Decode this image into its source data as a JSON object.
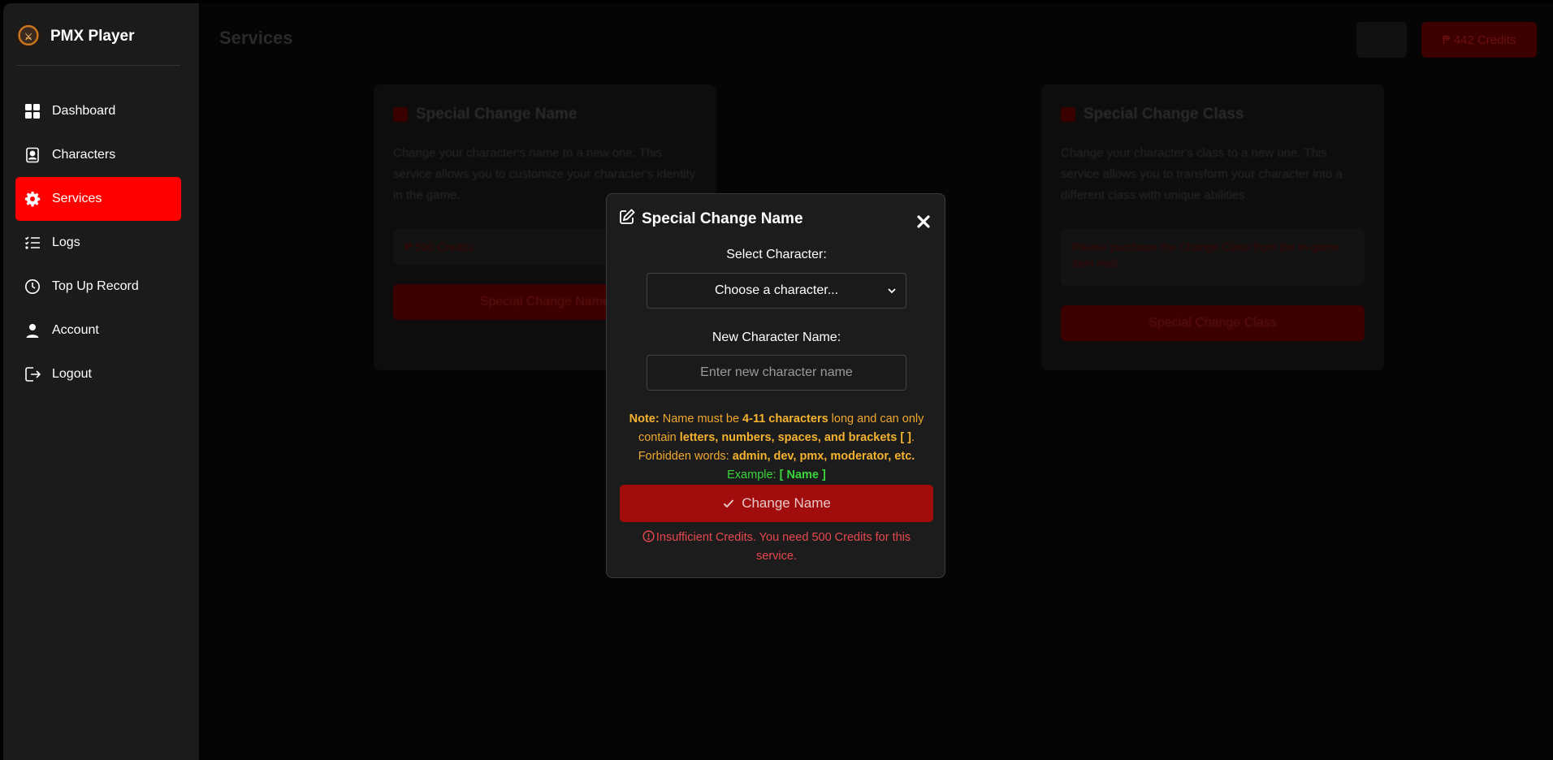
{
  "brand": {
    "title": "PMX Player"
  },
  "sidebar": {
    "items": [
      {
        "label": "Dashboard",
        "icon": "dashboard-icon",
        "active": false
      },
      {
        "label": "Characters",
        "icon": "character-card-icon",
        "active": false
      },
      {
        "label": "Services",
        "icon": "gear-icon",
        "active": true
      },
      {
        "label": "Logs",
        "icon": "list-icon",
        "active": false
      },
      {
        "label": "Top Up Record",
        "icon": "clock-icon",
        "active": false
      },
      {
        "label": "Account",
        "icon": "user-icon",
        "active": false
      },
      {
        "label": "Logout",
        "icon": "logout-icon",
        "active": false
      }
    ]
  },
  "header": {
    "title": "Services",
    "credits": "₱ 442 Credits"
  },
  "cards": [
    {
      "title": "Special Change Name",
      "description": "Change your character's name to a new one. This service allows you to customize your character's identity in the game.",
      "price": "₱ 500 Credits",
      "button": "Special Change Name"
    },
    {
      "title": "Special Change Class",
      "description": "Change your character's class to a new one. This service allows you to transform your character into a different class with unique abilities.",
      "notice": "Please purchase the Change Class from the in-game item mall.",
      "button": "Special Change Class"
    }
  ],
  "modal": {
    "title": "Special Change Name",
    "select_label": "Select Character:",
    "select_value": "Choose a character...",
    "name_label": "New Character Name:",
    "name_placeholder": "Enter new character name",
    "note": {
      "prefix": "Note:",
      "t1": " Name must be ",
      "b1": "4-11 characters",
      "t2": " long and can only contain ",
      "b2": "letters, numbers, spaces, and brackets [ ]",
      "t3": ".",
      "t4": "Forbidden words: ",
      "b3": "admin, dev, pmx, moderator, etc.",
      "example_label": "Example: ",
      "example_value": "[ Name ]"
    },
    "submit_label": "Change Name",
    "error": "Insufficient Credits. You need 500 Credits for this service."
  },
  "colors": {
    "accent": "#ff0000",
    "button": "#a10d0d",
    "warning": "#f0a830",
    "success": "#3ad63a",
    "error": "#e8474f"
  }
}
